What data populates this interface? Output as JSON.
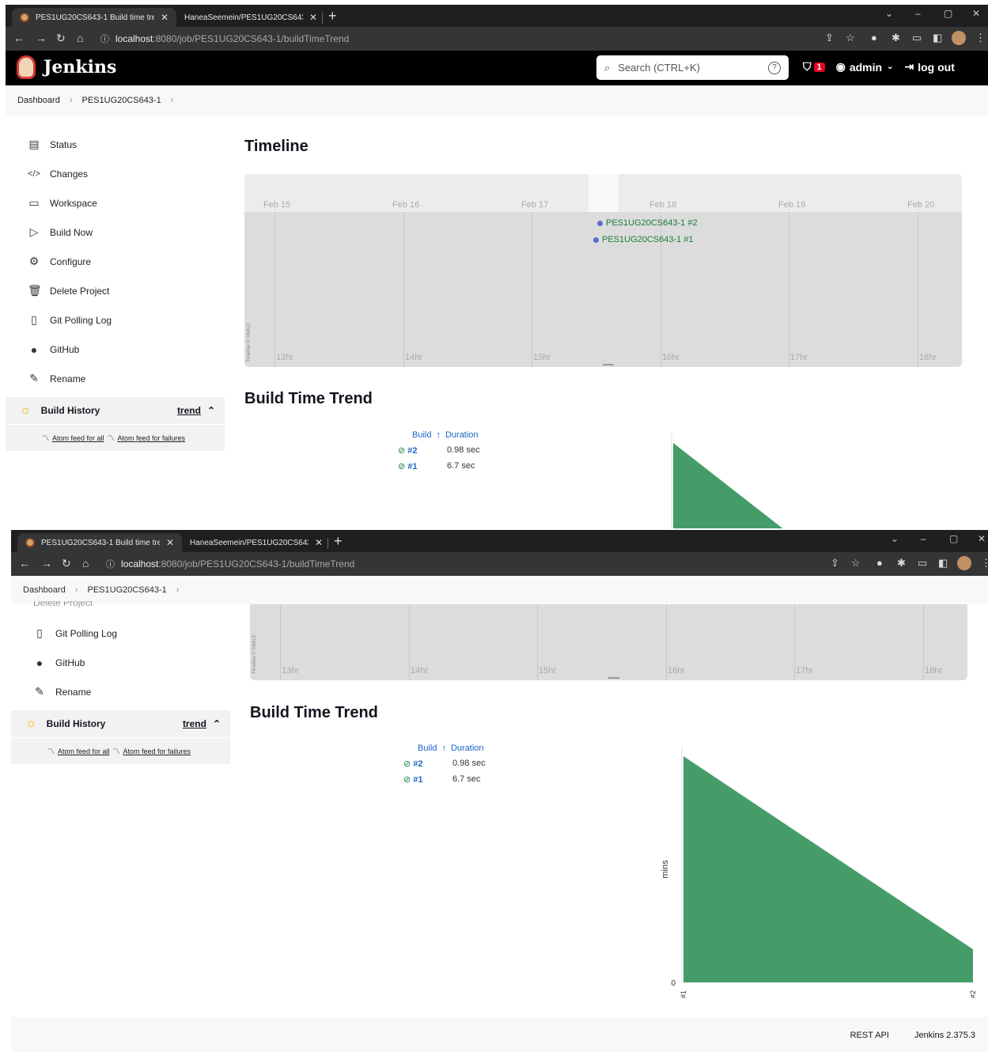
{
  "browser": {
    "tabs": [
      {
        "title": "PES1UG20CS643-1 Build time tre"
      },
      {
        "title": "HaneaSeemein/PES1UG20CS643"
      }
    ],
    "url_host": "localhost",
    "url_path": ":8080/job/PES1UG20CS643-1/buildTimeTrend"
  },
  "header": {
    "logo_text": "Jenkins",
    "search_placeholder": "Search (CTRL+K)",
    "security_count": "1",
    "user": "admin",
    "logout": "log out"
  },
  "breadcrumb": {
    "items": [
      "Dashboard",
      "PES1UG20CS643-1"
    ]
  },
  "sidebar": {
    "items": [
      {
        "label": "Status",
        "icon": "status-icon"
      },
      {
        "label": "Changes",
        "icon": "code-icon"
      },
      {
        "label": "Workspace",
        "icon": "folder-icon"
      },
      {
        "label": "Build Now",
        "icon": "play-icon"
      },
      {
        "label": "Configure",
        "icon": "gear-icon"
      },
      {
        "label": "Delete Project",
        "icon": "trash-icon"
      },
      {
        "label": "Git Polling Log",
        "icon": "clipboard-icon"
      },
      {
        "label": "GitHub",
        "icon": "github-icon"
      },
      {
        "label": "Rename",
        "icon": "pencil-icon"
      }
    ],
    "partial_items": [
      "Configure",
      "Delete Project"
    ],
    "build_history": {
      "title": "Build History",
      "trend": "trend",
      "feed_all": "Atom feed for all",
      "feed_failures": "Atom feed for failures"
    }
  },
  "timeline": {
    "title": "Timeline",
    "dates": [
      "Feb 15",
      "Feb 16",
      "Feb 17",
      "Feb 18",
      "Feb 19",
      "Feb 20"
    ],
    "hours": [
      "13hr",
      "14hr",
      "15hr",
      "16hr",
      "17hr",
      "18hr"
    ],
    "events": [
      "PES1UG20CS643-1 #2",
      "PES1UG20CS643-1 #1"
    ],
    "credit": "Timeline © SIMILE"
  },
  "trend": {
    "title": "Build Time Trend",
    "col_build": "Build",
    "sort_arrow": "↑",
    "col_duration": "Duration",
    "rows": [
      {
        "build": "#2",
        "duration": "0.98 sec"
      },
      {
        "build": "#1",
        "duration": "6.7 sec"
      }
    ]
  },
  "chart_data": {
    "type": "area",
    "categories": [
      "#1",
      "#2"
    ],
    "series": [
      {
        "values": [
          6.7,
          0.98
        ]
      }
    ],
    "ylabel": "mins",
    "yticks": [
      "0"
    ],
    "color": "#469c69"
  },
  "footer": {
    "rest_api": "REST API",
    "version": "Jenkins 2.375.3"
  }
}
